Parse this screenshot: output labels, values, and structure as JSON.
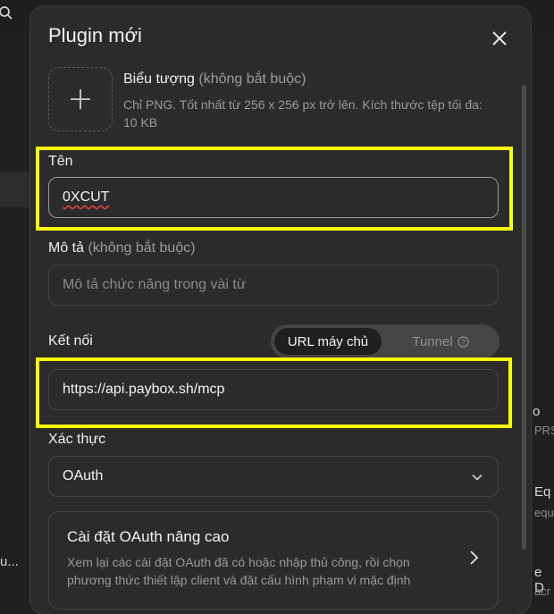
{
  "background": {
    "right_lines": [
      "o",
      "PRS",
      "Eq",
      "equ",
      "e D",
      "acr"
    ],
    "left_line": "u..."
  },
  "dialog": {
    "title": "Plugin mới",
    "icon_field": {
      "label": "Biểu tượng",
      "optional": "(không bắt buộc)",
      "description": "Chỉ PNG. Tốt nhất từ 256 x 256 px trở lên. Kích thước tệp tối đa: 10 KB"
    },
    "name_field": {
      "label": "Tên",
      "value": "0XCUT"
    },
    "description_field": {
      "label": "Mô tả",
      "optional": "(không bắt buộc)",
      "placeholder": "Mô tả chức năng trong vài từ"
    },
    "connection": {
      "label": "Kết nối",
      "options": [
        "URL máy chủ",
        "Tunnel"
      ],
      "selected": "URL máy chủ",
      "value": "https://api.paybox.sh/mcp"
    },
    "auth": {
      "label": "Xác thực",
      "value": "OAuth"
    },
    "advanced": {
      "title": "Cài đặt OAuth nâng cao",
      "description": "Xem lại các cài đặt OAuth đã có hoặc nhập thủ công, rồi chọn phương thức thiết lập client và đặt cấu hình phạm vi mặc định"
    }
  },
  "colors": {
    "highlight": "#ffff00",
    "dialog_bg": "#2b2b2b"
  }
}
